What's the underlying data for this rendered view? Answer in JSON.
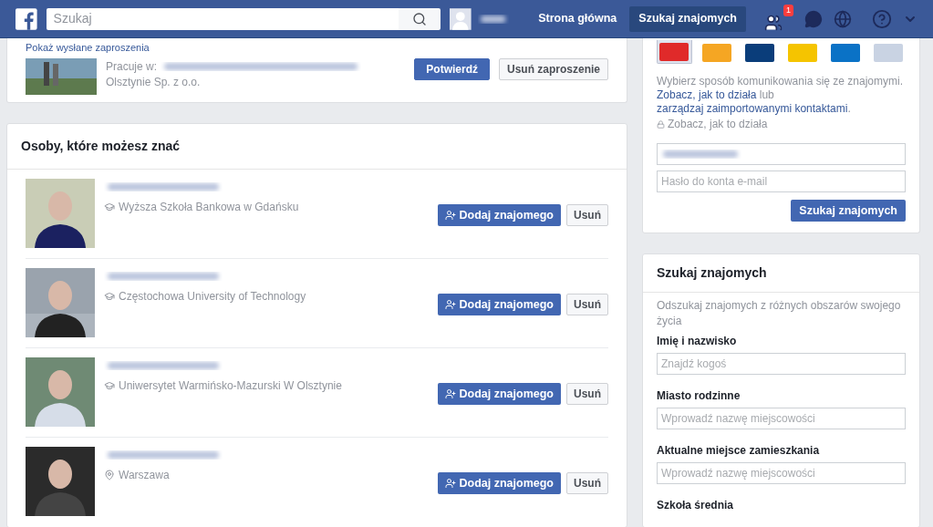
{
  "header": {
    "search": {
      "placeholder": "Szukaj"
    },
    "nav": [
      {
        "label": "Strona główna",
        "selected": false
      },
      {
        "label": "Szukaj znajomych",
        "selected": true
      }
    ],
    "friend_requests_badge": "1"
  },
  "friend_request": {
    "link": "Pokaż wysłane zaproszenia",
    "work_prefix": "Pracuje w:",
    "work_suffix": "Olsztynie Sp. z o.o.",
    "confirm": "Potwierdź",
    "delete": "Usuń zaproszenie"
  },
  "suggestions": {
    "title": "Osoby, które możesz znać",
    "people": [
      {
        "kind": "school",
        "detail": "Wyższa Szkoła Bankowa w Gdańsku",
        "add": "Dodaj znajomego",
        "remove": "Usuń"
      },
      {
        "kind": "school",
        "detail": "Częstochowa University of Technology",
        "add": "Dodaj znajomego",
        "remove": "Usuń"
      },
      {
        "kind": "school",
        "detail": "Uniwersytet Warmińsko-Mazurski W Olsztynie",
        "add": "Dodaj znajomego",
        "remove": "Usuń"
      },
      {
        "kind": "place",
        "detail": "Warszawa",
        "add": "Dodaj znajomego",
        "remove": "Usuń"
      }
    ]
  },
  "contact_import": {
    "providers": [
      {
        "color": "#e02a2a",
        "selected": true
      },
      {
        "color": "#f5a623",
        "selected": false
      },
      {
        "color": "#0a3d7a",
        "selected": false
      },
      {
        "color": "#f5c400",
        "selected": false
      },
      {
        "color": "#0a72c6",
        "selected": false
      },
      {
        "color": "#c9d3e3",
        "selected": false
      }
    ],
    "intro": [
      {
        "kind": "text",
        "text": "Wybierz sposób komunikowania się ze znajomymi."
      },
      {
        "kind": "link",
        "text": "Zobacz, jak to działa"
      },
      {
        "kind": "text",
        "text": "lub"
      },
      {
        "kind": "link",
        "text": "zarządzaj zaimportowanymi kontaktami"
      },
      {
        "kind": "text",
        "text": "."
      }
    ],
    "privacy": "Zobacz, jak to działa",
    "password_placeholder": "Hasło do konta e-mail",
    "button": "Szukaj znajomych"
  },
  "search_friends": {
    "title": "Szukaj znajomych",
    "description": "Odszukaj znajomych z różnych obszarów swojego życia",
    "fields": [
      {
        "label": "Imię i nazwisko",
        "placeholder": "Znajdź kogoś"
      },
      {
        "label": "Miasto rodzinne",
        "placeholder": "Wprowadź nazwę miejscowości"
      },
      {
        "label": "Aktualne miejsce zamieszkania",
        "placeholder": "Wprowadź nazwę miejscowości"
      }
    ],
    "cut_label": "Szkoła średnia"
  }
}
